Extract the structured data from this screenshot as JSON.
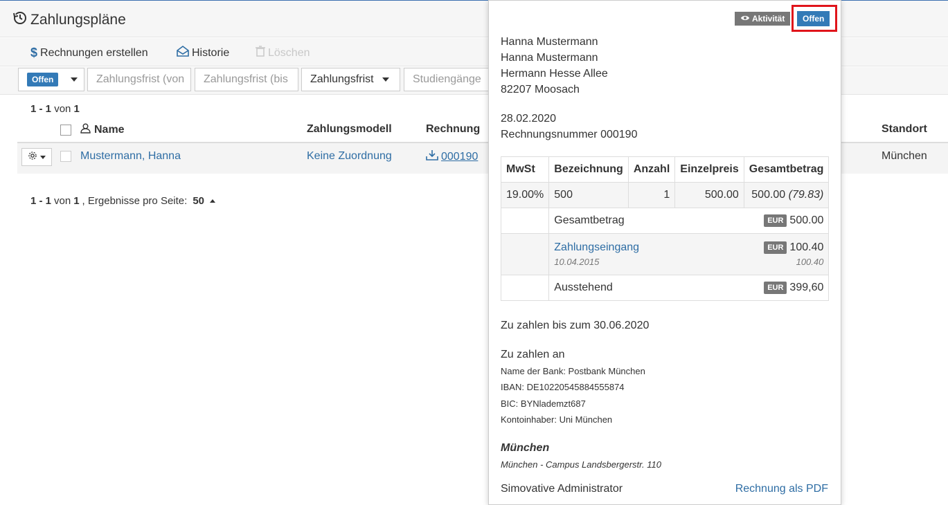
{
  "page": {
    "title": "Zahlungspläne"
  },
  "toolbar": {
    "create_label": "Rechnungen erstellen",
    "history_label": "Historie",
    "delete_label": "Löschen"
  },
  "filters": {
    "status_value": "Offen",
    "due_from_placeholder": "Zahlungsfrist (von",
    "due_to_placeholder": "Zahlungsfrist (bis",
    "due_select_label": "Zahlungsfrist",
    "programs_placeholder": "Studiengänge"
  },
  "results": {
    "range": "1 - 1",
    "von": "von",
    "total": "1",
    "per_page_label": ", Ergebnisse pro Seite:",
    "per_page_value": "50"
  },
  "table": {
    "columns": {
      "name": "Name",
      "model": "Zahlungsmodell",
      "invoice": "Rechnung",
      "location": "Standort"
    },
    "rows": [
      {
        "name": "Mustermann, Hanna",
        "model": "Keine Zuordnung",
        "invoice": "000190",
        "location": "München"
      }
    ]
  },
  "popover": {
    "activity_label": "Aktivität",
    "status_label": "Offen",
    "recipient_link": "Hanna Mustermann",
    "address": [
      "Hanna Mustermann",
      "Hermann Hesse Allee",
      "82207 Moosach"
    ],
    "date": "28.02.2020",
    "invoice_number_label": "Rechnungsnummer 000190",
    "invoice_table": {
      "headers": [
        "MwSt",
        "Bezeichnung",
        "Anzahl",
        "Einzelpreis",
        "Gesamtbetrag"
      ],
      "item": {
        "vat": "19.00%",
        "description": "500",
        "quantity": "1",
        "unit_price": "500.00",
        "total": "500.00",
        "total_vat": "(79.83)"
      },
      "currency": "EUR",
      "total_label": "Gesamtbetrag",
      "total_value": "500.00",
      "payment_label": "Zahlungseingang",
      "payment_date": "10.04.2015",
      "payment_value": "100.40",
      "payment_sub_value": "100.40",
      "outstanding_label": "Ausstehend",
      "outstanding_value": "399,60"
    },
    "due_text": "Zu zahlen bis zum 30.06.2020",
    "pay_to_label": "Zu zahlen an",
    "bank": [
      "Name der Bank: Postbank München",
      "IBAN: DE10220545884555874",
      "BIC: BYNlademzt687",
      "Kontoinhaber: Uni München"
    ],
    "location_title": "München",
    "location_sub": "München - Campus Landsbergerstr. 110",
    "admin_link": "Simovative Administrator",
    "pdf_link": "Rechnung als PDF"
  }
}
